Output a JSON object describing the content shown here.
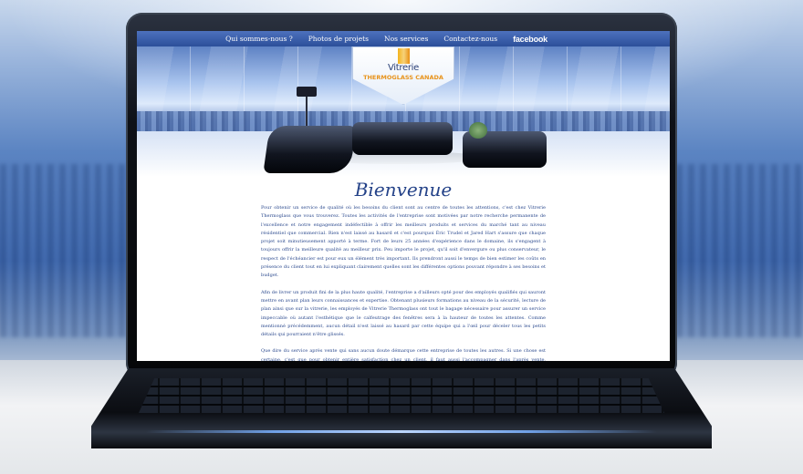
{
  "nav": {
    "items": [
      "Qui sommes-nous ?",
      "Photos de projets",
      "Nos services",
      "Contactez-nous"
    ],
    "facebook": "facebook"
  },
  "logo": {
    "line1": "Vitrerie",
    "line2": "THERMOGLASS CANADA"
  },
  "heading": "Bienvenue",
  "body": {
    "p1": "Pour obtenir un service de qualité où les besoins du client sont au centre de toutes les attentions, c'est chez Vitrerie Thermoglass que vous trouverez. Toutes les activités de l'entreprise sont motivées par notre recherche permanente de l'excellence et notre engagement indéfectible à offrir les meilleurs produits et services du marché tant au niveau résidentiel que commercial. Rien n'est laissé au hasard et c'est pourquoi Éric Trudel et Jared Hart s'assure que chaque projet soit minutieusement apporté à terme. Fort de leurs 25 années d'expérience dans le domaine, ils s'engagent à toujours offrir la meilleure qualité au meilleur prix. Peu importe le projet, qu'il soit d'envergure ou plus conservateur, le respect de l'échéancier est pour eux un élément très important. Ils prendront aussi le temps de bien estimer les coûts en présence du client tout en lui expliquant clairement quelles sont les différentes options pouvant répondre à ses besoins et budget.",
    "p2": "Afin de livrer un produit fini de la plus haute qualité, l'entreprise a d'ailleurs opté pour des employés qualifiés qui sauront mettre en avant plan leurs connaissances et expertise. Obtenant plusieurs formations au niveau de la sécurité, lecture de plan ainsi que sur la vitrerie, les employés de Vitrerie Thermoglass ont tout le bagage nécessaire pour assurer un service impeccable où autant l'esthétique que le calfeutrage des fenêtres sera à la hauteur de toutes les attentes. Comme mentionné précédemment, aucun détail n'est laissé au hasard par cette équipe qui a l'œil pour déceler tous les petits détails qui pourraient n'être glissés.",
    "p3": "Que dire du service après vente qui sans aucun doute démarque cette entreprise de toutes les autres. Si une chose est certaine, c'est que pour obtenir entière satisfaction chez un client, il faut aussi l'accompagner dans l'après vente, s'assurant de cette façon que les produits conviennent toujours à l'idée de départ et c'est exactement la façon de faire chez Vitrerie Thermoglass. Ici, qualité, expertise et confiance ne font qu'un!"
  }
}
